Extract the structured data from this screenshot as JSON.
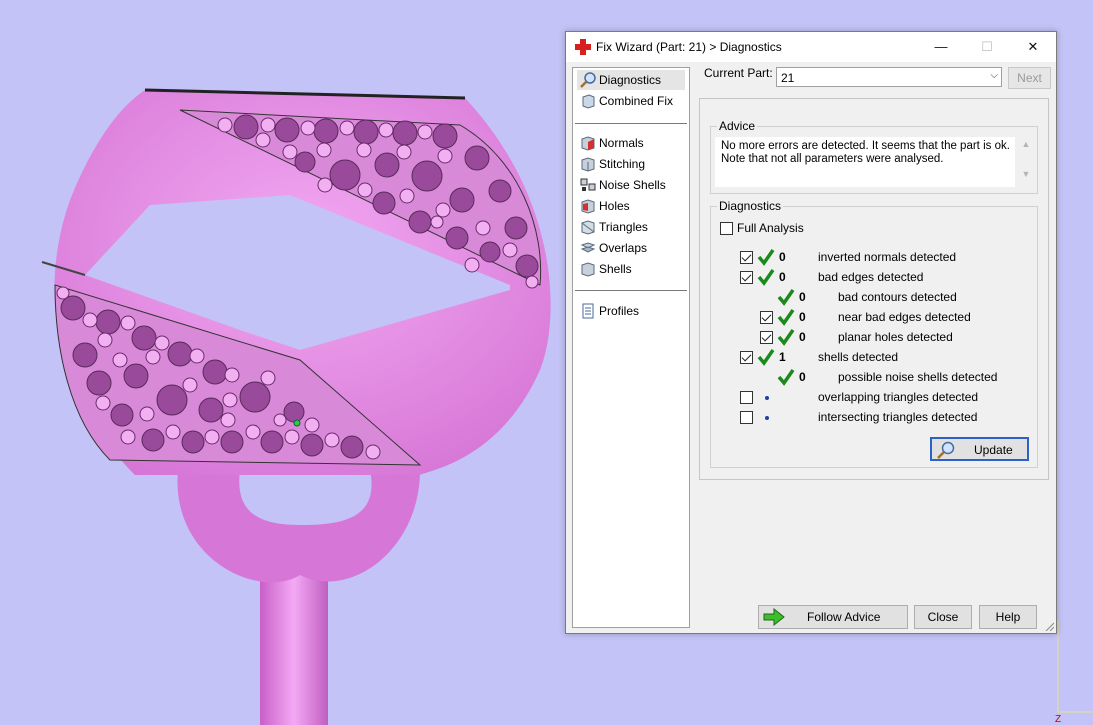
{
  "window": {
    "title": "Fix Wizard (Part: 21) > Diagnostics",
    "minimize_glyph": "—",
    "maximize_glyph": "☐",
    "close_glyph": "✕",
    "icon": "red-cross-icon"
  },
  "nav": {
    "items_top": [
      {
        "label": "Diagnostics",
        "icon": "magnifier-icon",
        "selected": true
      },
      {
        "label": "Combined Fix",
        "icon": "cube-icon",
        "selected": false
      }
    ],
    "items_fix": [
      {
        "label": "Normals",
        "icon": "normals-cube-icon"
      },
      {
        "label": "Stitching",
        "icon": "stitching-cube-icon"
      },
      {
        "label": "Noise Shells",
        "icon": "noise-shells-icon"
      },
      {
        "label": "Holes",
        "icon": "holes-cube-icon"
      },
      {
        "label": "Triangles",
        "icon": "triangles-icon"
      },
      {
        "label": "Overlaps",
        "icon": "overlaps-icon"
      },
      {
        "label": "Shells",
        "icon": "shells-cube-icon"
      }
    ],
    "items_bottom": [
      {
        "label": "Profiles",
        "icon": "document-icon"
      }
    ]
  },
  "current_part": {
    "label": "Current Part:",
    "value": "21",
    "next_label": "Next"
  },
  "advice": {
    "title": "Advice",
    "text_line1": "No more errors are detected. It seems that the part is ok.",
    "text_line2": "Note that not all parameters were analysed."
  },
  "diagnostics": {
    "title": "Diagnostics",
    "full_analysis_label": "Full Analysis",
    "full_analysis_checked": false,
    "rows": [
      {
        "label": "inverted normals detected",
        "count": "0",
        "checked": true,
        "status": "ok"
      },
      {
        "label": "bad edges detected",
        "count": "0",
        "checked": true,
        "status": "ok"
      },
      {
        "label": "bad contours detected",
        "count": "0",
        "checked": null,
        "status": "ok"
      },
      {
        "label": "near bad edges detected",
        "count": "0",
        "checked": true,
        "status": "ok"
      },
      {
        "label": "planar holes detected",
        "count": "0",
        "checked": true,
        "status": "ok"
      },
      {
        "label": "shells detected",
        "count": "1",
        "checked": true,
        "status": "ok"
      },
      {
        "label": "possible noise shells detected",
        "count": "0",
        "checked": null,
        "status": "ok"
      },
      {
        "label": "overlapping triangles detected",
        "count": "",
        "checked": false,
        "status": "pending"
      },
      {
        "label": "intersecting triangles detected",
        "count": "",
        "checked": false,
        "status": "pending"
      }
    ],
    "update_label": "Update"
  },
  "buttons": {
    "follow_advice": "Follow Advice",
    "close": "Close",
    "help": "Help"
  },
  "colors": {
    "viewport_bg": "#c3c3f7",
    "model_pink": "#e88ae8",
    "model_dark": "#8a3a8a",
    "check_green": "#1a8a1a"
  }
}
